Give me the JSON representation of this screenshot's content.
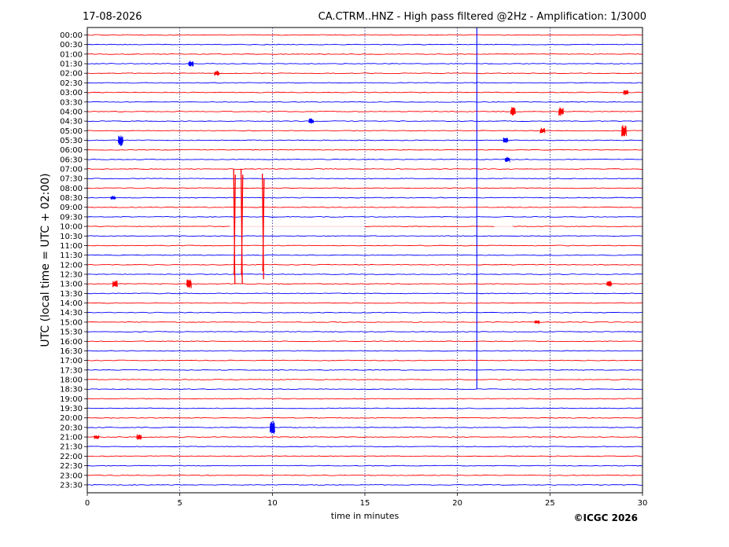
{
  "header": {
    "date": "17-08-2026",
    "title": "CA.CTRM..HNZ - High pass filtered @2Hz - Amplification: 1/3000"
  },
  "footer": {
    "copyright": "©ICGC 2026"
  },
  "chart_data": {
    "type": "line",
    "title": "CA.CTRM..HNZ - High pass filtered @2Hz - Amplification: 1/3000",
    "xlabel": "time in minutes",
    "ylabel": "UTC (local time = UTC + 02:00)",
    "xlim": [
      0,
      30
    ],
    "x_ticks": [
      "0",
      "5",
      "10",
      "15",
      "20",
      "25",
      "30"
    ],
    "y_ticks": [
      "00:00",
      "00:30",
      "01:00",
      "01:30",
      "02:00",
      "02:30",
      "03:00",
      "03:30",
      "04:00",
      "04:30",
      "05:00",
      "05:30",
      "06:00",
      "06:30",
      "07:00",
      "07:30",
      "08:00",
      "08:30",
      "09:00",
      "09:30",
      "10:00",
      "10:30",
      "11:00",
      "11:30",
      "12:00",
      "12:30",
      "13:00",
      "13:30",
      "14:00",
      "14:30",
      "15:00",
      "15:30",
      "16:00",
      "16:30",
      "17:00",
      "17:30",
      "18:00",
      "18:30",
      "19:00",
      "19:30",
      "20:00",
      "20:30",
      "21:00",
      "21:30",
      "22:00",
      "22:30",
      "23:00",
      "23:30"
    ],
    "trace_colors": [
      "#ff0000",
      "#0000ff"
    ],
    "grid": "vertical dotted at every 5 minutes",
    "events": [
      {
        "row": "01:30",
        "minute": 5.6,
        "amp": 0.3
      },
      {
        "row": "02:00",
        "minute": 7.0,
        "amp": 0.3
      },
      {
        "row": "03:00",
        "minute": 29.1,
        "amp": 0.3
      },
      {
        "row": "04:00",
        "minute": 23.0,
        "amp": 0.5
      },
      {
        "row": "04:00",
        "minute": 25.6,
        "amp": 0.45
      },
      {
        "row": "04:30",
        "minute": 12.1,
        "amp": 0.3
      },
      {
        "row": "05:00",
        "minute": 24.6,
        "amp": 0.3
      },
      {
        "row": "05:00",
        "minute": 29.0,
        "amp": 0.6
      },
      {
        "row": "05:30",
        "minute": 1.8,
        "amp": 0.6
      },
      {
        "row": "05:30",
        "minute": 22.6,
        "amp": 0.3
      },
      {
        "row": "06:30",
        "minute": 22.7,
        "amp": 0.3
      },
      {
        "row": "08:30",
        "minute": 1.4,
        "amp": 0.2
      },
      {
        "row": "10:00",
        "minute": 7.95,
        "amp": 6.0
      },
      {
        "row": "10:00",
        "minute": 8.35,
        "amp": 6.0
      },
      {
        "row": "10:00",
        "minute": 9.5,
        "amp": 5.5
      },
      {
        "row": "13:00",
        "minute": 1.5,
        "amp": 0.4
      },
      {
        "row": "13:00",
        "minute": 5.5,
        "amp": 0.5
      },
      {
        "row": "13:00",
        "minute": 28.2,
        "amp": 0.3
      },
      {
        "row": "15:00",
        "minute": 24.3,
        "amp": 0.2
      },
      {
        "row": "20:30",
        "minute": 10.0,
        "amp": 0.7
      },
      {
        "row": "21:00",
        "minute": 2.8,
        "amp": 0.3
      },
      {
        "row": "21:00",
        "minute": 0.5,
        "amp": 0.2
      }
    ],
    "gaps": [
      {
        "row": "10:00",
        "from_minute": 7.7,
        "to_minute": 15.0
      },
      {
        "row": "10:00",
        "from_minute": 22.0,
        "to_minute": 23.0
      }
    ],
    "spike_line": {
      "minute": 21.05,
      "from_row": "00:00",
      "to_row": "18:30",
      "color": "#0000ff"
    }
  }
}
